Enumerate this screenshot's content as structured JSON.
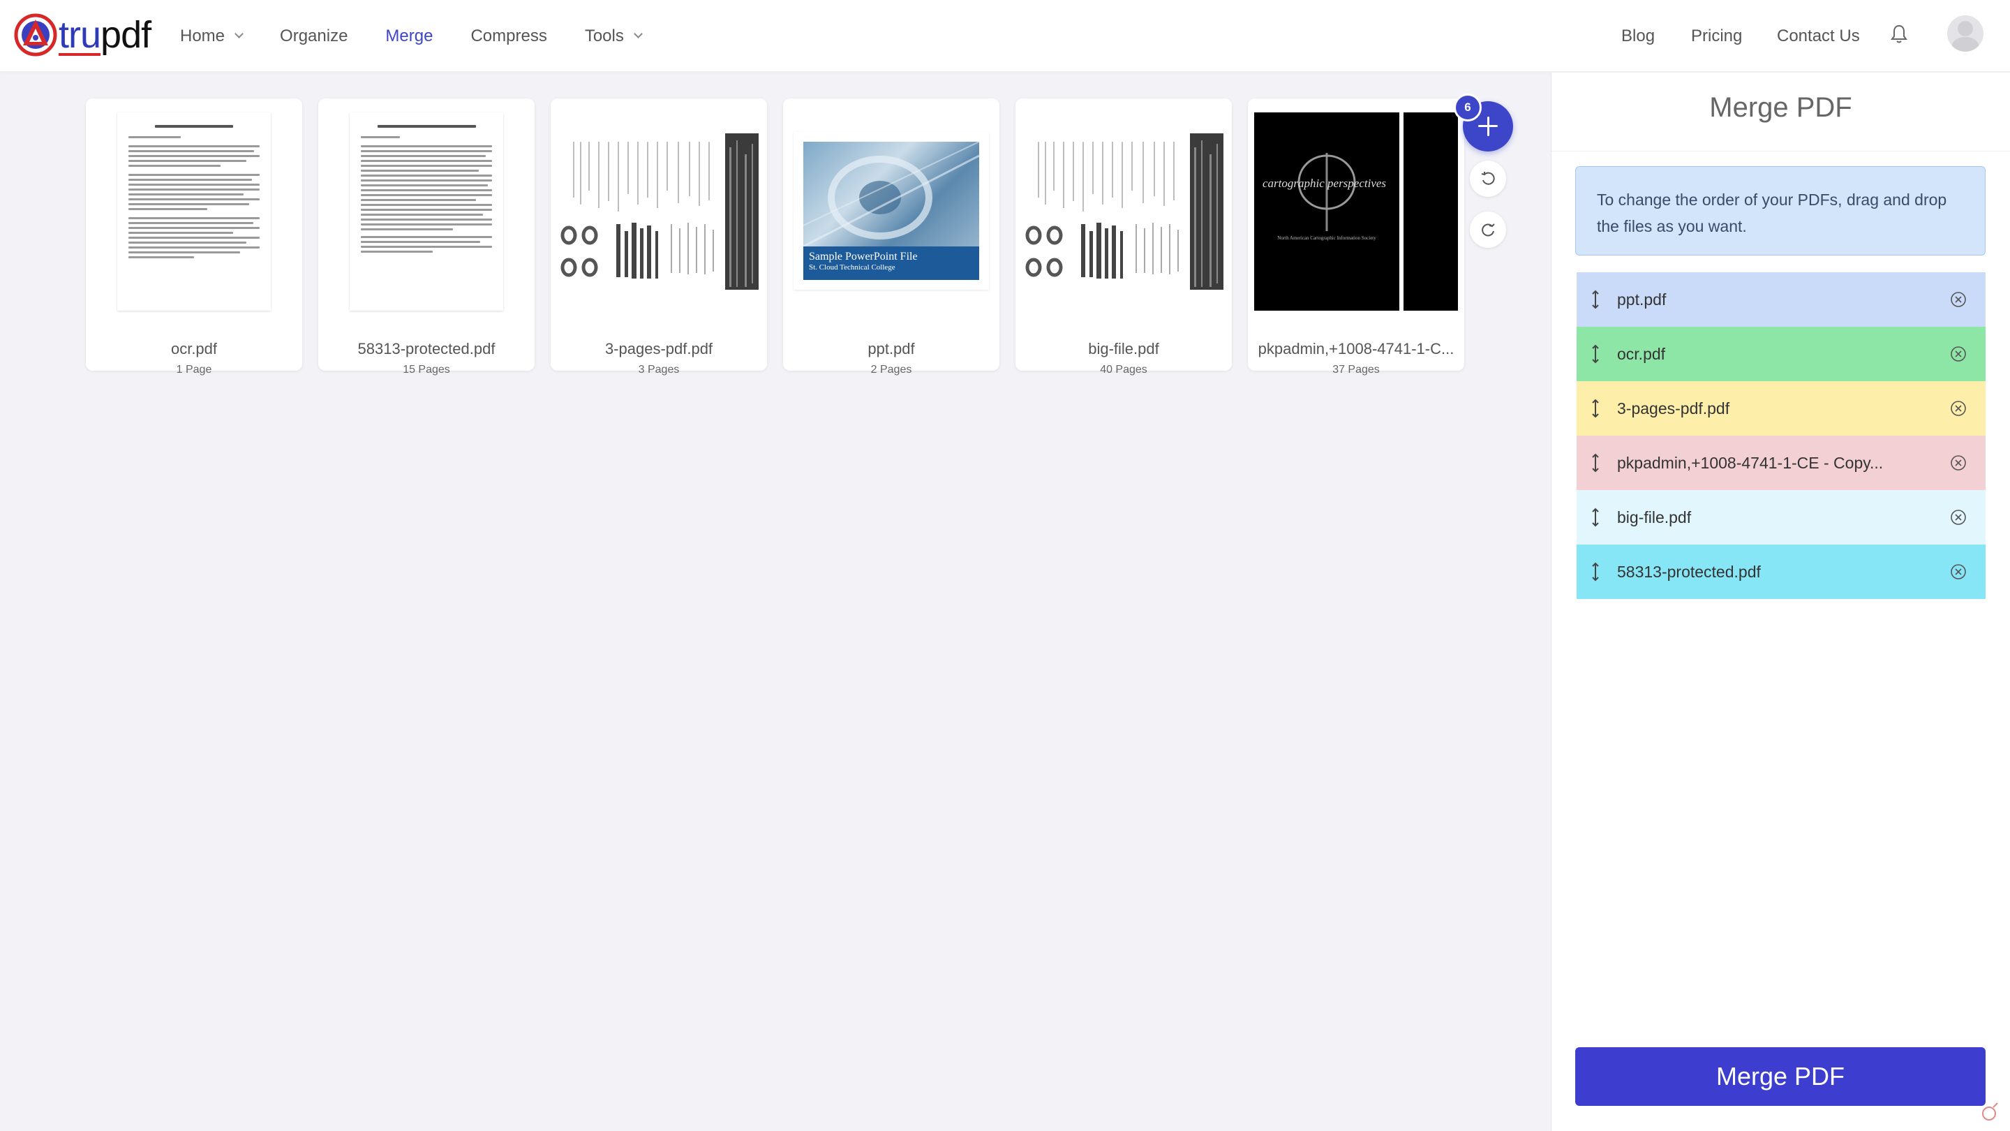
{
  "brand": {
    "name_part1": "tru",
    "name_part2": "pdf"
  },
  "nav": {
    "home": "Home",
    "organize": "Organize",
    "merge": "Merge",
    "compress": "Compress",
    "tools": "Tools",
    "blog": "Blog",
    "pricing": "Pricing",
    "contact": "Contact Us"
  },
  "files": [
    {
      "name": "ocr.pdf",
      "pages": "1 Page"
    },
    {
      "name": "58313-protected.pdf",
      "pages": "15 Pages"
    },
    {
      "name": "3-pages-pdf.pdf",
      "pages": "3 Pages"
    },
    {
      "name": "ppt.pdf",
      "pages": "2 Pages",
      "thumb_title": "Sample PowerPoint File",
      "thumb_subtitle": "St. Cloud Technical College"
    },
    {
      "name": "big-file.pdf",
      "pages": "40 Pages"
    },
    {
      "name": "pkpadmin,+1008-4741-1-C...",
      "pages": "37 Pages",
      "thumb_title": "cartographic perspectives"
    }
  ],
  "file_count": "6",
  "sidebar": {
    "title": "Merge PDF",
    "info": "To change the order of your PDFs, drag and drop the files as you want.",
    "order": [
      {
        "name": "ppt.pdf",
        "color": "#c9dbf9"
      },
      {
        "name": "ocr.pdf",
        "color": "#8ee6a6"
      },
      {
        "name": "3-pages-pdf.pdf",
        "color": "#fdeeaa"
      },
      {
        "name": "pkpadmin,+1008-4741-1-CE - Copy...",
        "color": "#f3d0d3"
      },
      {
        "name": "big-file.pdf",
        "color": "#e2f6fd"
      },
      {
        "name": "58313-protected.pdf",
        "color": "#86e6f6"
      }
    ],
    "merge_button": "Merge PDF"
  },
  "colors": {
    "accent": "#3d46c9",
    "button": "#3d3ecf",
    "logo_red": "#d62828"
  }
}
